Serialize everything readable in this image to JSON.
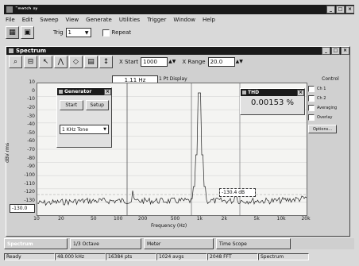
{
  "app": {
    "title": "ˉᵐᵃᵗᶜʰ ˢʸ",
    "menu": [
      "File",
      "Edit",
      "Sweep",
      "View",
      "Generate",
      "Utilities",
      "Trigger",
      "Window",
      "Help"
    ]
  },
  "toolbar": {
    "label_left": "Trig",
    "combo_value": "1",
    "checkbox_label": "Repeat"
  },
  "spectrum": {
    "title": "Spectrum",
    "xstart_label": "X Start",
    "xstart_value": "1000",
    "xrange_label": "X Range",
    "xrange_value": "20.0",
    "cursor_readout": "1.11 Hz",
    "cursor_mode": "1 Pt Display",
    "y_axis_label": "dBV rms",
    "x_axis_label": "Frequency (Hz)",
    "ref_box": "-130.0",
    "marker_label": "-130.4 dB",
    "y_ticks": [
      "10",
      "0",
      "-10",
      "-20",
      "-30",
      "-40",
      "-50",
      "-60",
      "-70",
      "-80",
      "-90",
      "-100",
      "-110",
      "-120",
      "-130",
      "-140"
    ],
    "x_ticks": [
      "10",
      "20",
      "50",
      "100",
      "200",
      "500",
      "1k",
      "2k",
      "5k",
      "10k",
      "20k"
    ],
    "control": {
      "title": "Control",
      "items": [
        "Ch 1",
        "Ch 2",
        "Averaging",
        "Overlay"
      ],
      "button": "Options..."
    }
  },
  "generator": {
    "title": "Generator",
    "buttons": [
      "Start",
      "Setup"
    ],
    "preset_value": "1 KHz Tone"
  },
  "thd": {
    "title": "THD",
    "value": "0.00153",
    "unit": "%"
  },
  "taskbar": {
    "items": [
      "Spectrum",
      "1/3 Octave",
      "Meter",
      "Time Scope"
    ]
  },
  "status": {
    "items": [
      "Ready",
      "48.000 kHz",
      "16384 pts",
      "1024 avgs",
      "2048 FFT",
      "Spectrum"
    ]
  }
}
